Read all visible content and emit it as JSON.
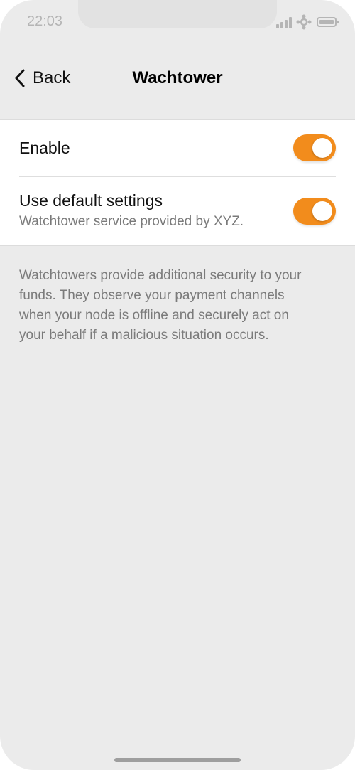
{
  "status_bar": {
    "time": "22:03",
    "icons": [
      "signal-icon",
      "network-icon",
      "battery-icon"
    ]
  },
  "nav": {
    "back_label": "Back",
    "title": "Wachtower"
  },
  "settings": {
    "enable": {
      "label": "Enable",
      "on": true
    },
    "default_settings": {
      "label": "Use default settings",
      "sublabel": "Watchtower service provided by XYZ.",
      "on": true
    }
  },
  "description": "Watchtowers provide additional security to your funds. They observe your payment channels when your node is offline and securely act on your behalf if a malicious situation occurs.",
  "colors": {
    "accent": "#f28c1c",
    "background": "#ebebeb",
    "card": "#ffffff"
  }
}
